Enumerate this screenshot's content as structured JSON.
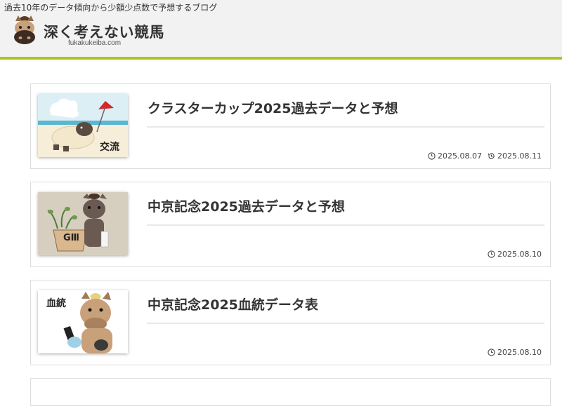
{
  "header": {
    "tagline": "過去10年のデータ傾向から少額少点数で予想するブログ",
    "site_title": "深く考えない競馬",
    "site_domain": "fukakukeiba.com",
    "accent_color": "#a8c521",
    "logo_icon": "horse-face-icon"
  },
  "articles": [
    {
      "title": "クラスターカップ2025過去データと予想",
      "thumb_label": "交流",
      "published": "2025.08.07",
      "updated": "2025.08.11"
    },
    {
      "title": "中京記念2025過去データと予想",
      "thumb_label": "GⅢ",
      "published": "2025.08.10"
    },
    {
      "title": "中京記念2025血統データ表",
      "thumb_label": "血統",
      "published": "2025.08.10"
    }
  ]
}
